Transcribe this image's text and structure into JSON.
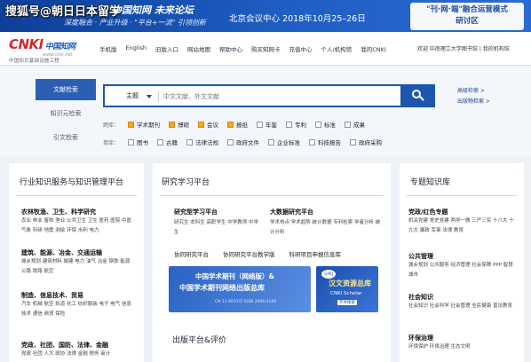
{
  "banner": {
    "watermark": "搜狐号@朝日日本留学",
    "slogan1": "中国知网 未来论坛",
    "slogan2": "深度融合 · 产业升级 · \"平台+一流\" 引领创新",
    "venue": "北京会议中心 2018年10月25–26日",
    "cta_line1": "\"刊·网·端\"融合运营模式",
    "cta_line2": "研讨区"
  },
  "header": {
    "logo_main": "CNKI",
    "logo_cn": "中国知网",
    "logo_url": "www.cnki.net",
    "logo_sub": "中国知识基础设施工程",
    "nav": [
      "手机版",
      "English",
      "旧版入口",
      "网站地图",
      "帮助中心",
      "购买知网卡",
      "充值中心",
      "个人/机构馆",
      "我的CNKI"
    ],
    "right": "欢迎 中南理工大学图书馆 | 我的机构馆"
  },
  "search": {
    "side_tabs": [
      "文献检索",
      "知识元检索",
      "引文检索"
    ],
    "field": "主题",
    "placeholder": "中文文献、外文文献",
    "adv_links": [
      "高级检索 >",
      "出版物检索 >"
    ],
    "row1_label": "跨库：",
    "row1": [
      {
        "label": "学术期刊",
        "checked": true
      },
      {
        "label": "博硕",
        "checked": true
      },
      {
        "label": "会议",
        "checked": true
      },
      {
        "label": "报纸",
        "checked": true
      },
      {
        "label": "年鉴",
        "checked": false
      },
      {
        "label": "专利",
        "checked": false
      },
      {
        "label": "标准",
        "checked": false
      },
      {
        "label": "成果",
        "checked": false
      }
    ],
    "row2_label": "单库：",
    "row2": [
      {
        "label": "图书",
        "checked": false
      },
      {
        "label": "古籍",
        "checked": false
      },
      {
        "label": "法律法规",
        "checked": false
      },
      {
        "label": "政府文件",
        "checked": false
      },
      {
        "label": "企业标准",
        "checked": false
      },
      {
        "label": "科技报告",
        "checked": false
      },
      {
        "label": "政府采购",
        "checked": false
      }
    ]
  },
  "left_panel": {
    "title": "行业知识服务与知识管理平台",
    "categories": [
      {
        "heading": "农林牧渔、卫生、科学研究",
        "items": "农业  林业  畜牧  渔业  公共卫生  卫生  医药  医院  中医  气象  科研  地震  测绘  环保  水利  电力"
      },
      {
        "heading": "建筑、能源、冶金、交通运输",
        "items": "城乡规划  建筑材料  城建  电力  油气  冶金  钢铁  能源  公路  铁路  航空"
      },
      {
        "heading": "制造、信息技术、贸易",
        "items": "汽车  机械  航空  轨道  化工  纺织服装  电子  电气  信息技术  通信  商贸  保险"
      },
      {
        "heading": "党政、社团、国防、法律、金融",
        "items": "党政  社团  人大  政协  法律  金融  税务  审计"
      }
    ]
  },
  "mid_panel": {
    "title": "研究学习平台",
    "sub1_heading": "研究型学习平台",
    "sub1_items": "研究生  本科生  高职学生  中学教师  中学生",
    "sub2_heading": "大数据研究平台",
    "sub2_items": "学术热点  学术趋势  统计数据  专利检索  学者分析  统计分析",
    "buttons": [
      "协同研究平台",
      "协同研究平台教学版",
      "科研项目申报信息库"
    ],
    "promo_line1": "中国学术期刊（网络版）&",
    "promo_line2": "中国学术期刊网络出版总库",
    "promo_line3": "CN 11-6037/Z  ISSN 2096-4188",
    "promo2_badge": "GARJ",
    "promo2_line1": "汉文资源总库",
    "promo2_line2": "CNKI Scholar",
    "promo2_line3": "学术搜索",
    "pub_title": "出版平台&评价"
  },
  "right_panel": {
    "title": "专题知识库",
    "categories": [
      {
        "heading": "党政/红色专题",
        "items": "机关党建  党史党建  两学一做  三严三实  十八大  十九大  廉政  军事  法律  教育"
      },
      {
        "heading": "公共管理",
        "items": "城乡规划  公共服务  经济管理  社会保障  PPP  智慧城市"
      },
      {
        "heading": "社会知识",
        "items": "社会知识  社会科学  社会管理  全民健康  普法教育"
      },
      {
        "heading": "环保治理",
        "items": "环境保护  环境治理  生态文明"
      }
    ]
  }
}
